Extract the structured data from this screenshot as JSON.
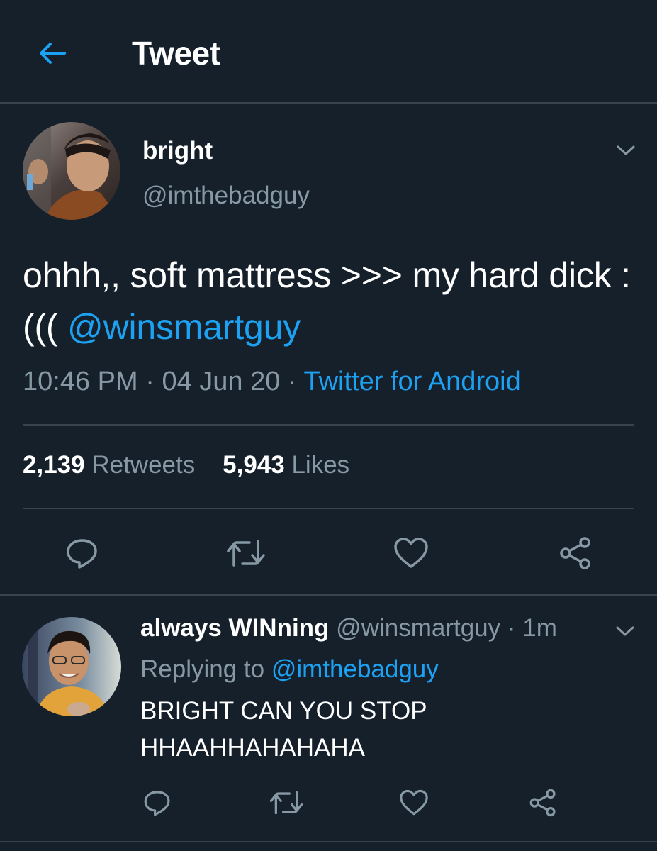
{
  "header": {
    "title": "Tweet",
    "back_icon": "arrow-left-icon"
  },
  "tweet": {
    "author_name": "bright",
    "author_handle": "@imthebadguy",
    "text_before": "ohhh,, soft mattress >>> my hard dick :((( ",
    "mention": "@winsmartguy",
    "time": "10:46 PM",
    "sep1": " · ",
    "date": "04 Jun 20",
    "sep2": " · ",
    "source": "Twitter for Android",
    "retweets_count": "2,139",
    "retweets_label": "Retweets",
    "likes_count": "5,943",
    "likes_label": "Likes",
    "actions": [
      "comment-icon",
      "retweet-icon",
      "like-icon",
      "share-icon"
    ]
  },
  "reply": {
    "author_name": "always WINning",
    "author_handle": "@winsmartguy",
    "sep": " · ",
    "time": "1m",
    "replying_label": "Replying to ",
    "replying_to": "@imthebadguy",
    "text": "BRIGHT CAN YOU STOP\nHHAAHHAHAHAHA"
  },
  "colors": {
    "background": "#15202b",
    "accent": "#1da1f2",
    "muted": "#8899a6",
    "divider": "#38444d"
  }
}
